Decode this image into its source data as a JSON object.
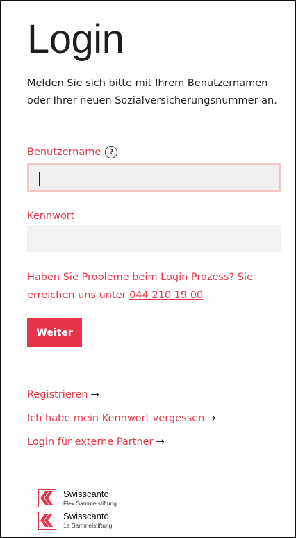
{
  "page": {
    "title": "Login",
    "intro": "Melden Sie sich bitte mit Ihrem Benutzernamen oder Ihrer neuen Sozialversicherungsnummer an."
  },
  "form": {
    "username_label": "Benutzername",
    "username_value": "",
    "password_label": "Kennwort",
    "password_value": "",
    "help_icon": "question-circle-icon",
    "help_prefix": "Haben Sie Probleme beim Login Prozess? Sie erreichen uns unter ",
    "help_phone": "044 210 19 00",
    "submit_label": "Weiter"
  },
  "links": [
    {
      "label": "Registrieren",
      "arrow": "→"
    },
    {
      "label": "Ich habe mein Kennwort vergessen",
      "arrow": "→"
    },
    {
      "label": "Login für externe Partner",
      "arrow": "→"
    }
  ],
  "logos": [
    {
      "name": "Swisscanto",
      "sub": "Flex Sammelstiftung"
    },
    {
      "name": "Swisscanto",
      "sub": "1e Sammelstiftung"
    }
  ],
  "colors": {
    "accent": "#e8344a",
    "link": "#e43a4a",
    "input_bg": "#f2f2f2",
    "focus_border": "#f4c4c7"
  }
}
